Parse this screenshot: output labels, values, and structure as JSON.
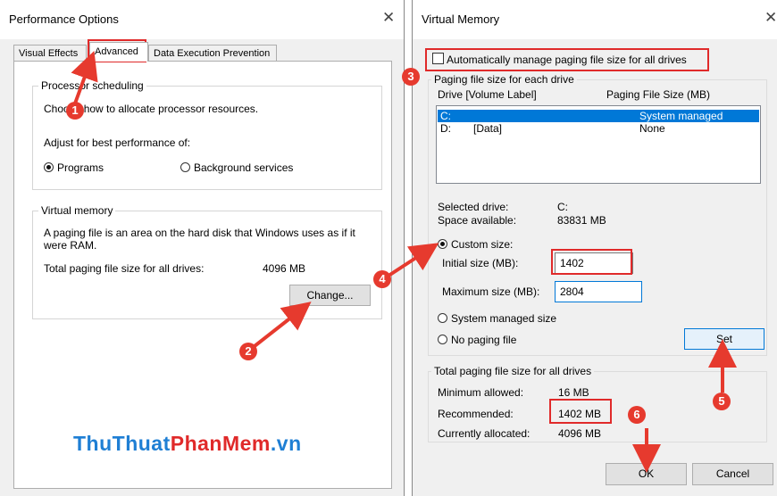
{
  "left_window": {
    "title": "Performance Options",
    "close_glyph": "✕",
    "tabs": [
      "Visual Effects",
      "Advanced",
      "Data Execution Prevention"
    ],
    "processor": {
      "legend": "Processor scheduling",
      "description": "Choose how to allocate processor resources.",
      "adjust_label": "Adjust for best performance of:",
      "options": [
        "Programs",
        "Background services"
      ],
      "selected": "Programs"
    },
    "virtual_memory": {
      "legend": "Virtual memory",
      "description": "A paging file is an area on the hard disk that Windows uses as if it were RAM.",
      "total_label": "Total paging file size for all drives:",
      "total_value": "4096 MB",
      "change_button": "Change..."
    },
    "watermark": {
      "part1": "ThuThuat",
      "part2": "PhanMem",
      "part3": ".vn"
    }
  },
  "right_window": {
    "title": "Virtual Memory",
    "close_glyph": "✕",
    "auto_manage_label": "Automatically manage paging file size for all drives",
    "auto_manage_checked": false,
    "paging_group_legend": "Paging file size for each drive",
    "list_headers": {
      "drive": "Drive  [Volume Label]",
      "size": "Paging File Size (MB)"
    },
    "drives": [
      {
        "drive": "C:",
        "label": "",
        "size": "System managed",
        "selected": true
      },
      {
        "drive": "D:",
        "label": "[Data]",
        "size": "None",
        "selected": false
      }
    ],
    "selected_drive_label": "Selected drive:",
    "selected_drive_value": "C:",
    "space_label": "Space available:",
    "space_value": "83831 MB",
    "custom_size_label": "Custom size:",
    "initial_label": "Initial size (MB):",
    "initial_value": "1402",
    "maximum_label": "Maximum size (MB):",
    "maximum_value": "2804",
    "system_managed_label": "System managed size",
    "no_paging_label": "No paging file",
    "set_button": "Set",
    "total_group_legend": "Total paging file size for all drives",
    "min_label": "Minimum allowed:",
    "min_value": "16 MB",
    "recommended_label": "Recommended:",
    "recommended_value": "1402 MB",
    "current_label": "Currently allocated:",
    "current_value": "4096 MB",
    "ok_button": "OK",
    "cancel_button": "Cancel"
  },
  "annotations": [
    "1",
    "2",
    "3",
    "4",
    "5",
    "6"
  ],
  "colors": {
    "annotation_red": "#e63a2e",
    "selection_blue": "#0078d7",
    "watermark_blue": "#1f7fd4",
    "watermark_red": "#e02a2a"
  }
}
